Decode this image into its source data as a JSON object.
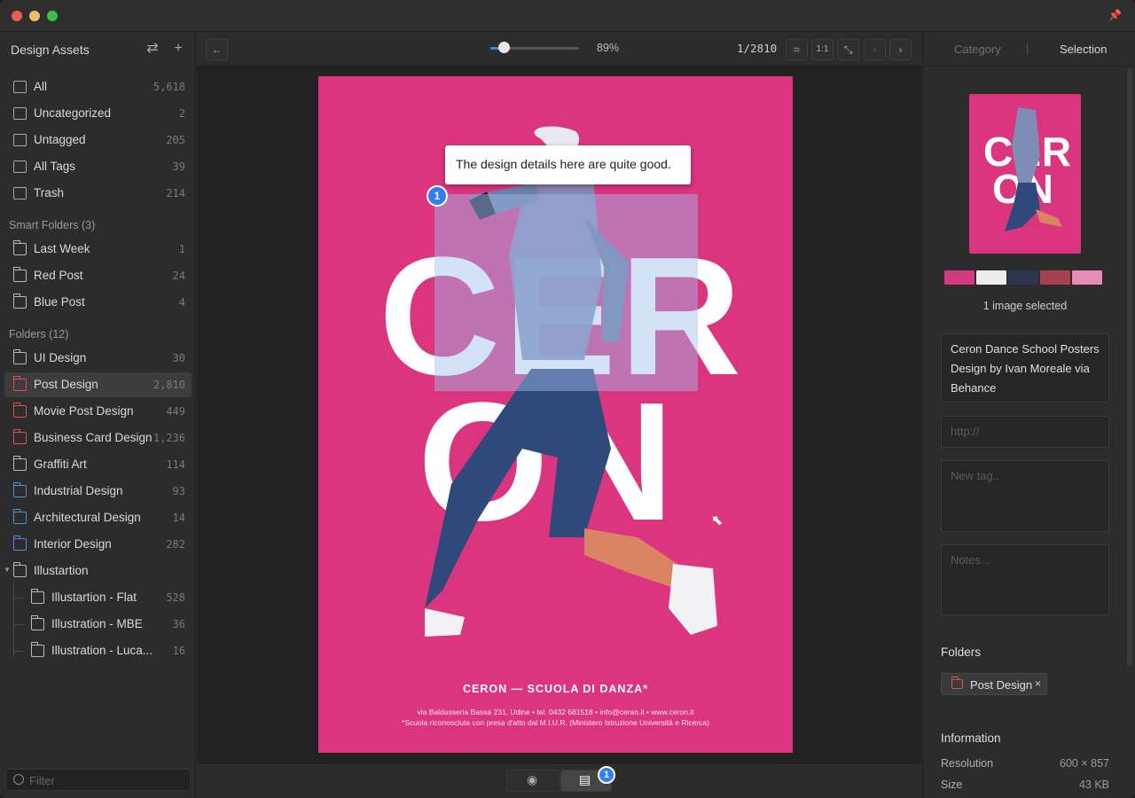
{
  "sidebar": {
    "title": "Design Assets",
    "library": [
      {
        "label": "All",
        "count": "5,618"
      },
      {
        "label": "Uncategorized",
        "count": "2"
      },
      {
        "label": "Untagged",
        "count": "205"
      },
      {
        "label": "All Tags",
        "count": "39"
      },
      {
        "label": "Trash",
        "count": "214"
      }
    ],
    "smart_folders_heading": "Smart Folders (3)",
    "smart_folders": [
      {
        "label": "Last Week",
        "count": "1"
      },
      {
        "label": "Red Post",
        "count": "24"
      },
      {
        "label": "Blue Post",
        "count": "4"
      }
    ],
    "folders_heading": "Folders (12)",
    "folders": [
      {
        "label": "UI Design",
        "count": "30"
      },
      {
        "label": "Post Design",
        "count": "2,810"
      },
      {
        "label": "Movie Post Design",
        "count": "449"
      },
      {
        "label": "Business Card Design",
        "count": "1,236"
      },
      {
        "label": "Graffiti Art",
        "count": "114"
      },
      {
        "label": "Industrial Design",
        "count": "93"
      },
      {
        "label": "Architectural Design",
        "count": "14"
      },
      {
        "label": "Interior Design",
        "count": "282"
      },
      {
        "label": "Illustartion",
        "count": ""
      },
      {
        "label": "Illustartion - Flat",
        "count": "528"
      },
      {
        "label": "Illustration - MBE",
        "count": "36"
      },
      {
        "label": "Illustration - Luca...",
        "count": "16"
      }
    ],
    "filter_placeholder": "Filter"
  },
  "toolbar": {
    "zoom": "89%",
    "zoom_fraction": 0.15,
    "pager": "1/2810",
    "actual_size_label": "1:1"
  },
  "poster": {
    "letters_top": "CER",
    "letters_bottom": "ON",
    "title": "CERON — SCUOLA DI DANZA*",
    "footer_line1": "via Baldasseria Bassa 231, Udine • tel. 0432 681518 • info@ceran.it • www.ceron.it",
    "footer_line2": "*Scuola riconosciuta con presa d'atto dal M.I.U.R. (Ministero Istruzione Università e Ricerca)",
    "comment": "The design details here are quite good.",
    "marker_number": "1"
  },
  "bottom": {
    "comment_badge": "1"
  },
  "right": {
    "tab_category": "Category",
    "tab_selection": "Selection",
    "thumb_letters_top": "CER",
    "thumb_letters_bottom": "ON",
    "palette": [
      "#d6397f",
      "#ededed",
      "#2a3550",
      "#a8414f",
      "#e98bb8"
    ],
    "selected_text": "1 image selected",
    "description": "Ceron Dance School Posters Design by Ivan Moreale via Behance",
    "url_placeholder": "http://",
    "tag_placeholder": "New tag..",
    "notes_placeholder": "Notes...",
    "folders_heading": "Folders",
    "folder_chip": "Post Design",
    "information_heading": "Information",
    "resolution_label": "Resolution",
    "resolution_value": "600 × 857",
    "size_label": "Size",
    "size_value": "43 KB"
  }
}
